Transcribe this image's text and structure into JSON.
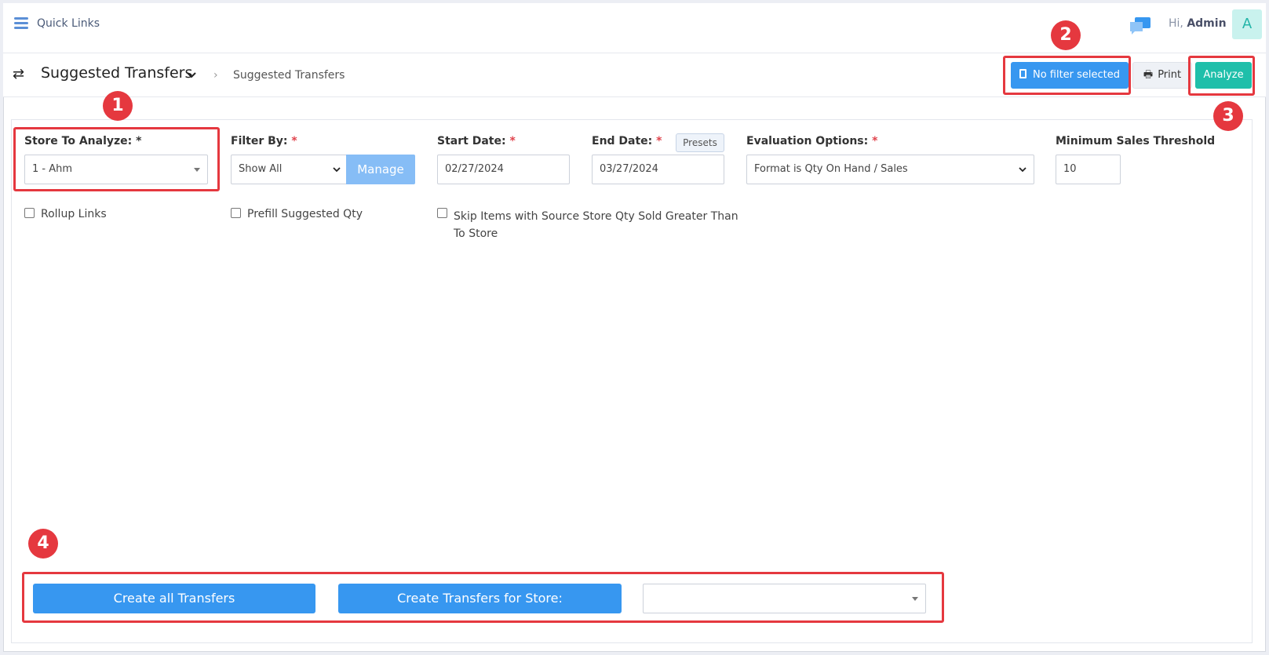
{
  "topbar": {
    "quick_links": "Quick Links",
    "greeting_prefix": "Hi,",
    "user_name": "Admin",
    "avatar_initial": "A"
  },
  "header": {
    "title": "Suggested Transfers",
    "breadcrumb": "Suggested Transfers",
    "filter_button": "No filter selected",
    "print_button": "Print",
    "analyze_button": "Analyze"
  },
  "form": {
    "store_label": "Store To Analyze:",
    "store_required": "*",
    "store_value": "1 - Ahm",
    "filter_label": "Filter By:",
    "filter_required": "*",
    "filter_value": "Show All",
    "manage_button": "Manage",
    "start_label": "Start Date:",
    "start_required": "*",
    "start_value": "02/27/2024",
    "end_label": "End Date:",
    "end_required": "*",
    "end_value": "03/27/2024",
    "presets_button": "Presets",
    "eval_label": "Evaluation Options:",
    "eval_required": "*",
    "eval_value": "Format is Qty On Hand / Sales",
    "threshold_label": "Minimum Sales Threshold",
    "threshold_value": "10",
    "rollup_label": "Rollup Links",
    "prefill_label": "Prefill Suggested Qty",
    "skip_label_line1": "Skip Items with Source Store Qty Sold Greater Than",
    "skip_label_line2": "To Store"
  },
  "actions": {
    "create_all": "Create all Transfers",
    "create_for_store": "Create Transfers for Store:",
    "store_select_value": ""
  },
  "annotations": [
    "1",
    "2",
    "3",
    "4"
  ],
  "colors": {
    "primary": "#3797f0",
    "accent": "#1fbfaa",
    "annotation": "#e5383f"
  }
}
